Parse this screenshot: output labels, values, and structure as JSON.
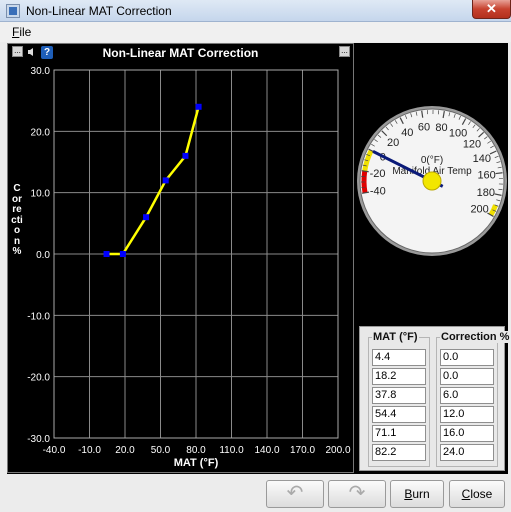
{
  "window": {
    "title": "Non-Linear MAT Correction",
    "close_glyph": "✕"
  },
  "menu": {
    "file_label": "File",
    "file_mnemonic": "F",
    "file_rest": "ile"
  },
  "chart_header": {
    "title": "Non-Linear MAT Correction",
    "help_glyph": "?",
    "left_btn_glyph": "...",
    "right_btn_glyph": "..."
  },
  "chart_data": {
    "type": "line",
    "title": "Non-Linear MAT Correction",
    "xlabel": "MAT (°F)",
    "ylabel": "Correction %",
    "x_ticks": [
      "-40.0",
      "-10.0",
      "20.0",
      "50.0",
      "80.0",
      "110.0",
      "140.0",
      "170.0",
      "200.0"
    ],
    "y_ticks": [
      "30.0",
      "20.0",
      "10.0",
      "0.0",
      "-10.0",
      "-20.0",
      "-30.0"
    ],
    "xlim": [
      -40,
      200
    ],
    "ylim": [
      -30,
      30
    ],
    "grid": true,
    "x": [
      4.4,
      18.2,
      37.8,
      54.4,
      71.1,
      82.2
    ],
    "y": [
      0.0,
      0.0,
      6.0,
      12.0,
      16.0,
      24.0
    ],
    "line_color": "#ffff00",
    "point_color": "#0000ff"
  },
  "gauge": {
    "title": "Manifold Air Temp",
    "units": "0(°F)",
    "labels": [
      "-40",
      "-20",
      "0",
      "20",
      "40",
      "60",
      "80",
      "100",
      "120",
      "140",
      "160",
      "180",
      "200"
    ],
    "min": -40,
    "max": 200,
    "value": 0
  },
  "table": {
    "col1_header": "MAT (°F)",
    "col2_header": "Correction %",
    "mat": [
      "4.4",
      "18.2",
      "37.8",
      "54.4",
      "71.1",
      "82.2"
    ],
    "correction": [
      "0.0",
      "0.0",
      "6.0",
      "12.0",
      "16.0",
      "24.0"
    ]
  },
  "buttons": {
    "undo_glyph": "↶",
    "redo_glyph": "↷",
    "burn": "Burn",
    "burn_mnemonic": "B",
    "burn_rest": "urn",
    "close": "Close",
    "close_mnemonic": "C",
    "close_rest": "lose"
  }
}
